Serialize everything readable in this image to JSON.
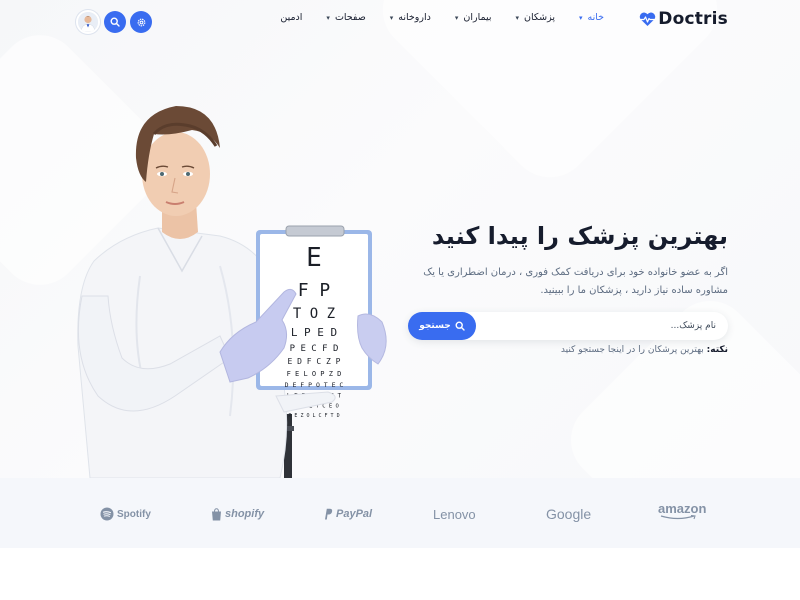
{
  "header": {
    "logo_text": "Doctris",
    "nav": [
      {
        "label": "خانه",
        "active": true
      },
      {
        "label": "پزشکان",
        "active": false
      },
      {
        "label": "بیماران",
        "active": false
      },
      {
        "label": "داروخانه",
        "active": false
      },
      {
        "label": "صفحات",
        "active": false
      },
      {
        "label": "ادمین",
        "active": false
      }
    ],
    "icons": [
      "settings-icon",
      "search-icon",
      "user-avatar"
    ]
  },
  "hero": {
    "title": "بهترین پزشک را پیدا کنید",
    "description": "اگر به عضو خانواده خود برای دریافت کمک فوری ، درمان اضطراری یا یک مشاوره ساده نیاز دارید ، پزشکان ما را ببینید.",
    "search": {
      "placeholder": "نام پزشک...",
      "button_label": "جستجو"
    },
    "note_label": "نکته:",
    "note_text": "بهترین پرشکان را در اینجا جستجو کنید",
    "eye_chart_rows": [
      "E",
      "F P",
      "T O Z",
      "L P E D",
      "P E C F D",
      "E D F C Z P",
      "F E L O P Z D",
      "D E F P O T E C",
      "L E F O D P C T",
      "F D P L T C E O",
      "P E Z O L C F T D"
    ]
  },
  "brands": [
    "Spotify",
    "shopify",
    "PayPal",
    "Lenovo",
    "Google",
    "amazon"
  ],
  "colors": {
    "primary": "#396cf0",
    "text": "#161c2d",
    "muted": "#8492a6",
    "brand_strip_bg": "#f5f7fb"
  }
}
